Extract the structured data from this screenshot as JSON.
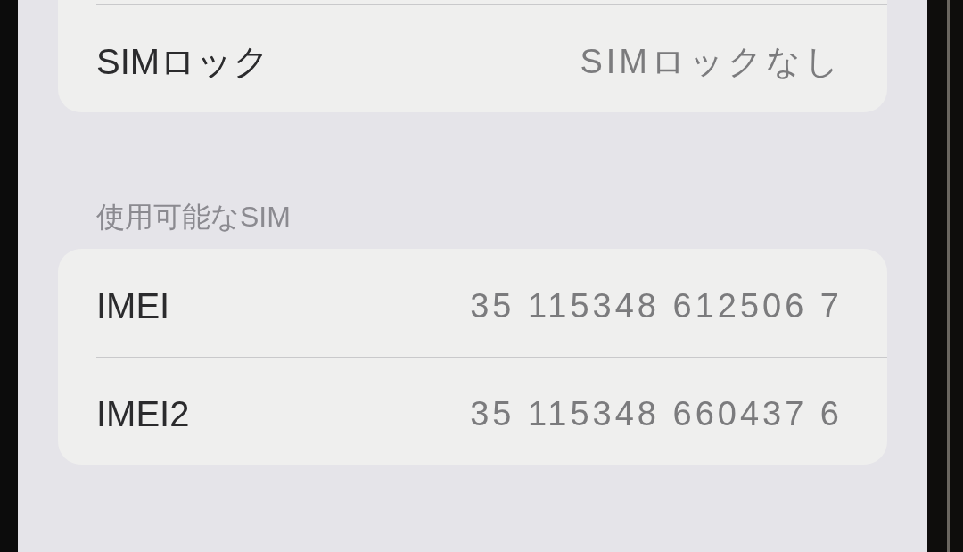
{
  "sections": [
    {
      "rows": [
        {
          "label": "SIMロック",
          "value": "SIMロックなし"
        }
      ]
    },
    {
      "header": "使用可能なSIM",
      "rows": [
        {
          "label": "IMEI",
          "value": "35 115348 612506 7"
        },
        {
          "label": "IMEI2",
          "value": "35 115348 660437 6"
        }
      ]
    }
  ]
}
